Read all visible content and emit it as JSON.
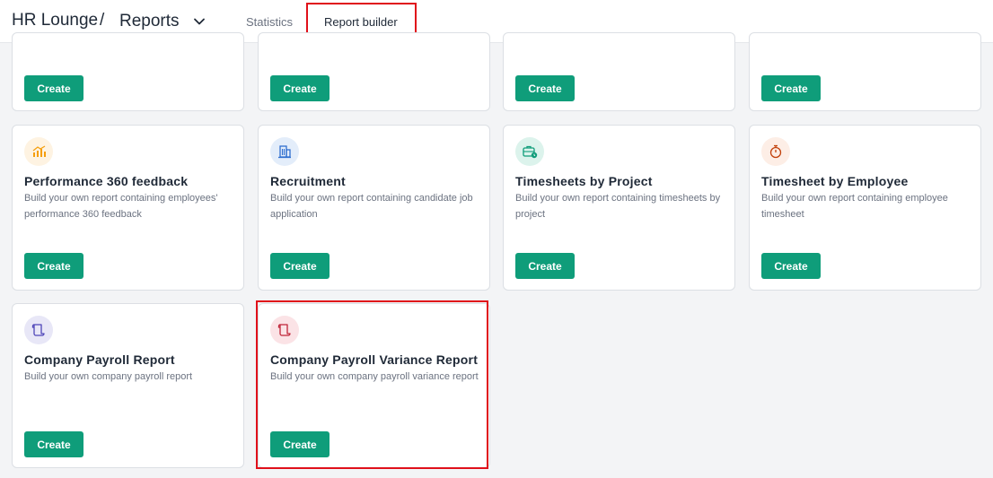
{
  "header": {
    "brand": "HR Lounge",
    "separator": "/",
    "section": "Reports",
    "tabs": [
      "Statistics",
      "Report builder"
    ],
    "active_tab": "Report builder"
  },
  "top_row": {
    "create_label": "Create"
  },
  "cards": [
    {
      "title": "Performance 360 feedback",
      "desc": "Build your own report containing employees' performance 360 feedback",
      "button": "Create",
      "icon": "bar-chart-icon",
      "icon_color": "#f59e0b",
      "icon_bg": "#fef3e2"
    },
    {
      "title": "Recruitment",
      "desc": "Build your own report containing candidate job application",
      "button": "Create",
      "icon": "building-icon",
      "icon_color": "#2f6fcf",
      "icon_bg": "#e3edfa"
    },
    {
      "title": "Timesheets by Project",
      "desc": "Build your own report containing timesheets by project",
      "button": "Create",
      "icon": "briefcase-clock-icon",
      "icon_color": "#0f9d7a",
      "icon_bg": "#dcf3ec"
    },
    {
      "title": "Timesheet by Employee",
      "desc": "Build your own report containing employee timesheet",
      "button": "Create",
      "icon": "stopwatch-icon",
      "icon_color": "#c2410c",
      "icon_bg": "#fdeee6"
    },
    {
      "title": "Company Payroll Report",
      "desc": "Build your own company payroll report",
      "button": "Create",
      "icon": "scroll-icon",
      "icon_color": "#4f46b8",
      "icon_bg": "#e8e7f7"
    },
    {
      "title": "Company Payroll Variance Report",
      "desc": "Build your own company payroll variance report",
      "button": "Create",
      "icon": "scroll-icon",
      "icon_color": "#c0263a",
      "icon_bg": "#fbe3e6"
    }
  ],
  "colors": {
    "accent": "#0f9d7a",
    "highlight": "#e0101a"
  }
}
